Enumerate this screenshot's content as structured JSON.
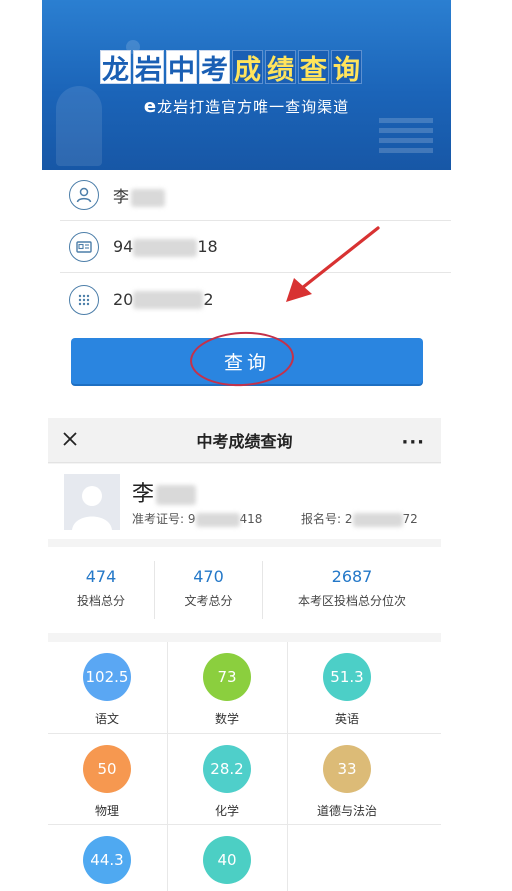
{
  "banner": {
    "title_chars": [
      {
        "char": "龙",
        "highlight": false
      },
      {
        "char": "岩",
        "highlight": false
      },
      {
        "char": "中",
        "highlight": false
      },
      {
        "char": "考",
        "highlight": false
      },
      {
        "char": "成",
        "highlight": true
      },
      {
        "char": "绩",
        "highlight": true
      },
      {
        "char": "查",
        "highlight": true
      },
      {
        "char": "询",
        "highlight": true
      }
    ],
    "subtitle_e": "e",
    "subtitle": "龙岩打造官方唯一查询渠道"
  },
  "form": {
    "name_value": "李",
    "exam_number_start": "94",
    "exam_number_end": "18",
    "registration_start": "20",
    "registration_end": "2",
    "user_icon": "user-icon",
    "id_card_icon": "id-card-icon",
    "keypad_icon": "keypad-icon"
  },
  "query_button": {
    "label": "查询"
  },
  "navbar": {
    "title": "中考成绩查询",
    "close_icon": "close-icon",
    "more": "···"
  },
  "profile": {
    "name": "李",
    "exam_label": "准考证号: 9",
    "exam_tail": "418",
    "reg_label": "报名号: 2",
    "reg_tail": "72"
  },
  "stats": [
    {
      "value": "474",
      "label": "投档总分"
    },
    {
      "value": "470",
      "label": "文考总分"
    },
    {
      "value": "2687",
      "label": "本考区投档总分位次"
    }
  ],
  "subjects": [
    {
      "score": "102.5",
      "name": "语文",
      "color": "#5aa7f3"
    },
    {
      "score": "73",
      "name": "数学",
      "color": "#8bcf3e"
    },
    {
      "score": "51.3",
      "name": "英语",
      "color": "#4ccfc7"
    },
    {
      "score": "50",
      "name": "物理",
      "color": "#f69850"
    },
    {
      "score": "28.2",
      "name": "化学",
      "color": "#4fcfca"
    },
    {
      "score": "33",
      "name": "道德与法治",
      "color": "#dcbb77"
    },
    {
      "score": "44.3",
      "name": "",
      "color": "#4fa9f1"
    },
    {
      "score": "40",
      "name": "",
      "color": "#4ccfc4"
    }
  ],
  "colors": {
    "banner_blue": "#1b64b8",
    "button_blue": "#2a85e0",
    "annotation_red": "#c4314a",
    "stat_blue": "#2478c8"
  }
}
